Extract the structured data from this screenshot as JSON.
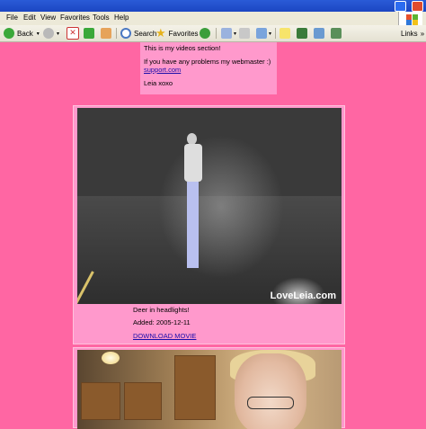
{
  "menu": [
    "File",
    "Edit",
    "View",
    "Favorites",
    "Tools",
    "Help"
  ],
  "toolbar": {
    "back": "Back",
    "search": "Search",
    "favorites": "Favorites",
    "links": "Links"
  },
  "intro": {
    "line1": "This is my videos section!",
    "line2": "If you have any problems my webmaster :)",
    "link": "support.com",
    "signoff": "Leia xoxo"
  },
  "videos": [
    {
      "watermark": "LoveLeia.com",
      "title": "Deer in headlights!",
      "added": "Added: 2005-12-11",
      "download": "DOWNLOAD MOVIE"
    }
  ],
  "colors": {
    "page_bg": "#ff66a3",
    "panel_bg": "#ff99cc",
    "link": "#1a0dab"
  }
}
